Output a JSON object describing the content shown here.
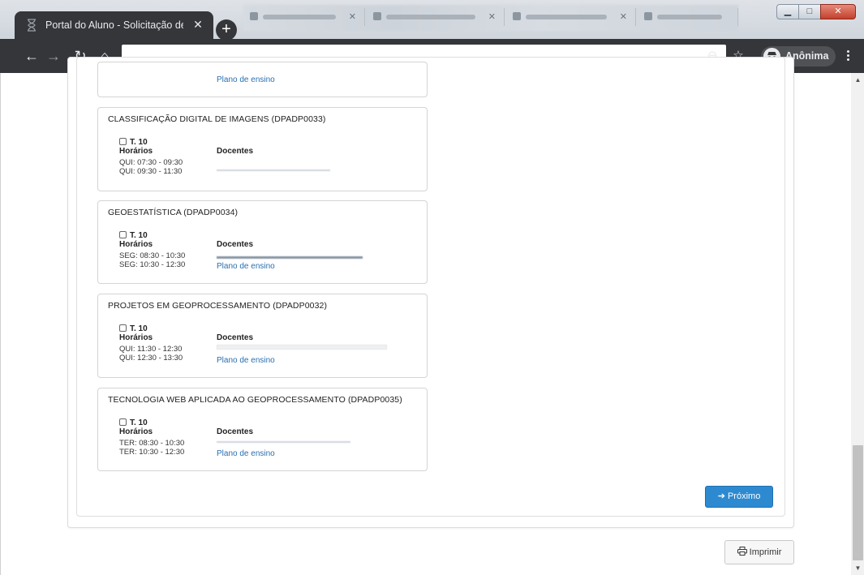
{
  "browser": {
    "tab_title": "Portal do Aluno - Solicitação de I",
    "new_tab": "+",
    "profile_label": "Anônima"
  },
  "courses": [
    {
      "title": "",
      "turma": "",
      "horarios": [],
      "plano": "Plano de ensino"
    },
    {
      "title": "CLASSIFICAÇÃO DIGITAL DE IMAGENS (DPADP0033)",
      "turma": "T. 10",
      "horarios_label": "Horários",
      "docentes_label": "Docentes",
      "horarios": [
        "QUI: 07:30 - 09:30",
        "QUI: 09:30 - 11:30"
      ],
      "plano": ""
    },
    {
      "title": "GEOESTATÍSTICA (DPADP0034)",
      "turma": "T. 10",
      "horarios_label": "Horários",
      "docentes_label": "Docentes",
      "horarios": [
        "SEG: 08:30 - 10:30",
        "SEG: 10:30 - 12:30"
      ],
      "plano": "Plano de ensino"
    },
    {
      "title": "PROJETOS EM GEOPROCESSAMENTO (DPADP0032)",
      "turma": "T. 10",
      "horarios_label": "Horários",
      "docentes_label": "Docentes",
      "horarios": [
        "QUI: 11:30 - 12:30",
        "QUI: 12:30 - 13:30"
      ],
      "plano": "Plano de ensino"
    },
    {
      "title": "TECNOLOGIA WEB APLICADA AO GEOPROCESSAMENTO (DPADP0035)",
      "turma": "T. 10",
      "horarios_label": "Horários",
      "docentes_label": "Docentes",
      "horarios": [
        "TER: 08:30 - 10:30",
        "TER: 10:30 - 12:30"
      ],
      "plano": "Plano de ensino"
    }
  ],
  "actions": {
    "next_label": "Próximo",
    "next_icon": "chevron-circle-right-icon",
    "print_label": "Imprimir",
    "print_icon": "printer-icon"
  }
}
